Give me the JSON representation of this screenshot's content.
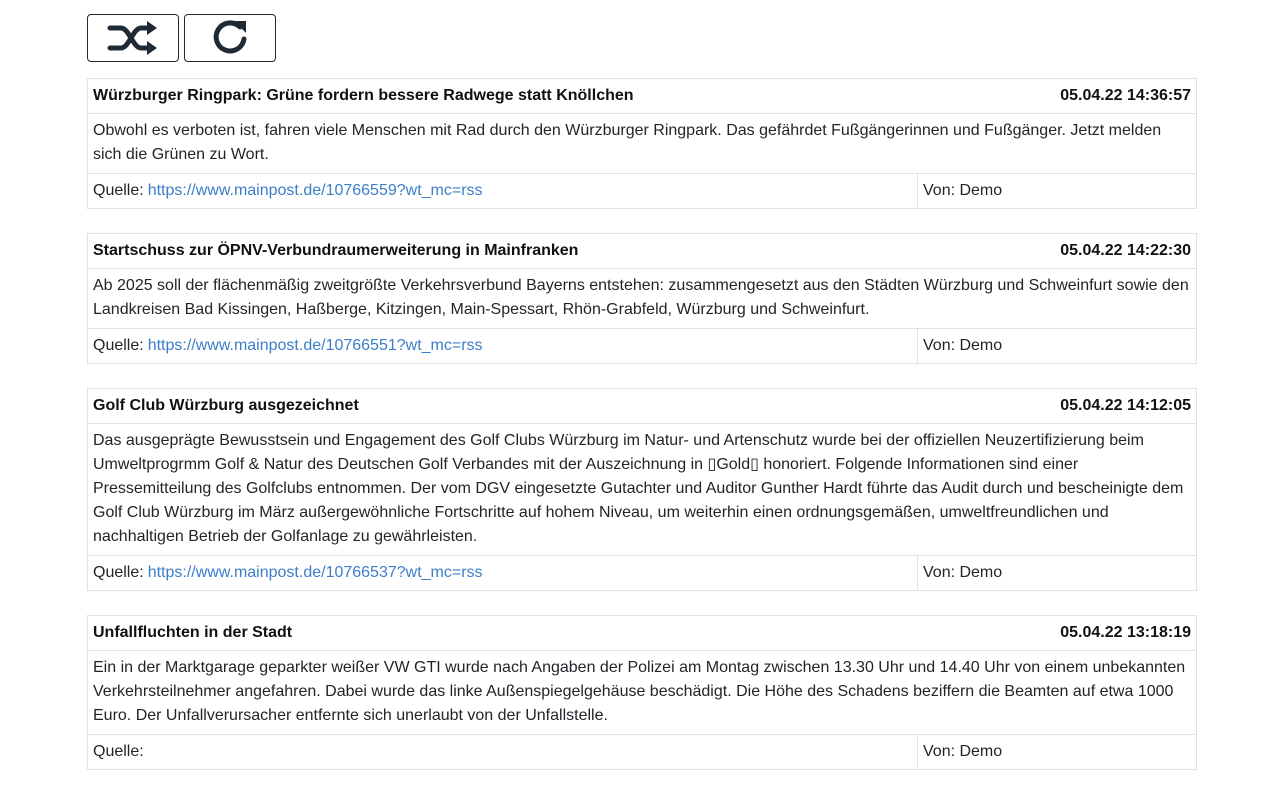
{
  "toolbar": {
    "shuffle_icon": "shuffle-icon",
    "reload_icon": "reload-icon"
  },
  "articles": [
    {
      "title": "Würzburger Ringpark: Grüne fordern bessere Radwege statt Knöllchen",
      "date": "05.04.22 14:36:57",
      "text": "Obwohl es verboten ist, fahren viele Menschen mit Rad durch den Würzburger Ringpark. Das gefährdet Fußgängerinnen und Fußgänger. Jetzt melden sich die Grünen zu Wort.",
      "source_label": "Quelle:",
      "source_url": "https://www.mainpost.de/10766559?wt_mc=rss",
      "author": "Von: Demo"
    },
    {
      "title": "Startschuss zur ÖPNV-Verbundraumerweiterung in Mainfranken",
      "date": "05.04.22 14:22:30",
      "text": "Ab 2025 soll der flächenmäßig zweitgrößte Verkehrsverbund Bayerns entstehen: zusammengesetzt aus den Städten Würzburg und Schweinfurt sowie den Landkreisen Bad Kissingen, Haßberge, Kitzingen, Main-Spessart, Rhön-Grabfeld, Würzburg und Schweinfurt.",
      "source_label": "Quelle:",
      "source_url": "https://www.mainpost.de/10766551?wt_mc=rss",
      "author": "Von: Demo"
    },
    {
      "title": "Golf Club Würzburg ausgezeichnet",
      "date": "05.04.22 14:12:05",
      "text": "Das ausgeprägte Bewusstsein und Engagement des Golf Clubs Würzburg im Natur- und Artenschutz wurde bei der offiziellen Neuzertifizierung beim Umweltprogrmm Golf & Natur des Deutschen Golf Verbandes mit der Auszeichnung in ▯Gold▯ honoriert. Folgende Informationen sind einer Pressemitteilung  des Golfclubs entnommen. Der vom DGV eingesetzte Gutachter und Auditor Gunther Hardt führte das Audit durch und bescheinigte dem Golf Club Würzburg im März  außergewöhnliche Fortschritte auf hohem Niveau, um weiterhin einen ordnungsgemäßen, umweltfreundlichen und nachhaltigen Betrieb der Golfanlage zu gewährleisten.",
      "source_label": "Quelle:",
      "source_url": "https://www.mainpost.de/10766537?wt_mc=rss",
      "author": "Von: Demo"
    },
    {
      "title": "Unfallfluchten in der Stadt",
      "date": "05.04.22 13:18:19",
      "text": "Ein in der Marktgarage geparkter weißer VW GTI wurde nach Angaben der Polizei am Montag zwischen 13.30 Uhr und 14.40 Uhr von einem unbekannten Verkehrsteilnehmer angefahren. Dabei wurde das linke Außenspiegelgehäuse beschädigt. Die Höhe des Schadens beziffern die Beamten auf etwa 1000 Euro. Der Unfallverursacher entfernte sich unerlaubt von der Unfallstelle.",
      "source_label": "Quelle:",
      "source_url": "",
      "author": "Von: Demo"
    }
  ]
}
